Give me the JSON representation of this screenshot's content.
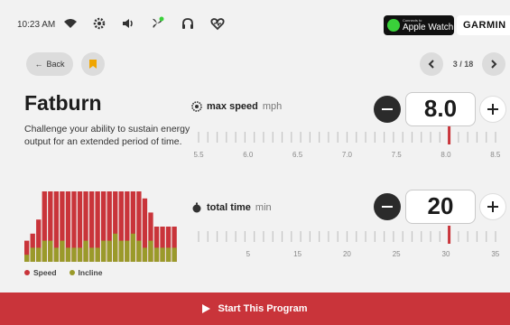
{
  "status": {
    "time": "10:23 AM",
    "icons": [
      "wifi-icon",
      "gear-icon",
      "speaker-icon",
      "fan-icon",
      "headphones-icon",
      "heart-rate-icon"
    ],
    "apple_watch": {
      "small": "Connects to",
      "label": "Apple Watch"
    },
    "garmin": "GARMIN"
  },
  "nav": {
    "back_label": "Back",
    "page_text": "3 / 18"
  },
  "program": {
    "title": "Fatburn",
    "description": "Challenge your ability to sustain energy output for an extended period of time."
  },
  "controls": [
    {
      "name": "max speed",
      "unit": "mph",
      "value": "8.0",
      "icon": "speedometer-icon",
      "ticks": [
        "5.5",
        "6.0",
        "6.5",
        "7.0",
        "7.5",
        "8.0",
        "8.5"
      ]
    },
    {
      "name": "total time",
      "unit": "min",
      "value": "20",
      "icon": "stopwatch-icon",
      "ticks": [
        "",
        "5",
        "15",
        "20",
        "25",
        "30",
        "35"
      ]
    }
  ],
  "chart": {
    "speed_color": "#c9343a",
    "incline_color": "#9a9a2a",
    "speed": [
      30,
      40,
      60,
      100,
      100,
      100,
      100,
      100,
      100,
      100,
      100,
      100,
      100,
      100,
      100,
      100,
      100,
      100,
      100,
      100,
      90,
      70,
      50,
      50,
      50,
      50
    ],
    "incline": [
      10,
      20,
      20,
      30,
      30,
      20,
      30,
      20,
      20,
      20,
      30,
      20,
      20,
      30,
      30,
      40,
      30,
      30,
      40,
      30,
      20,
      30,
      20,
      20,
      20,
      20
    ]
  },
  "legend": {
    "speed": "Speed",
    "incline": "Incline"
  },
  "start_label": "Start This Program",
  "colors": {
    "accent": "#c9343a",
    "background": "#f2f2f2"
  }
}
